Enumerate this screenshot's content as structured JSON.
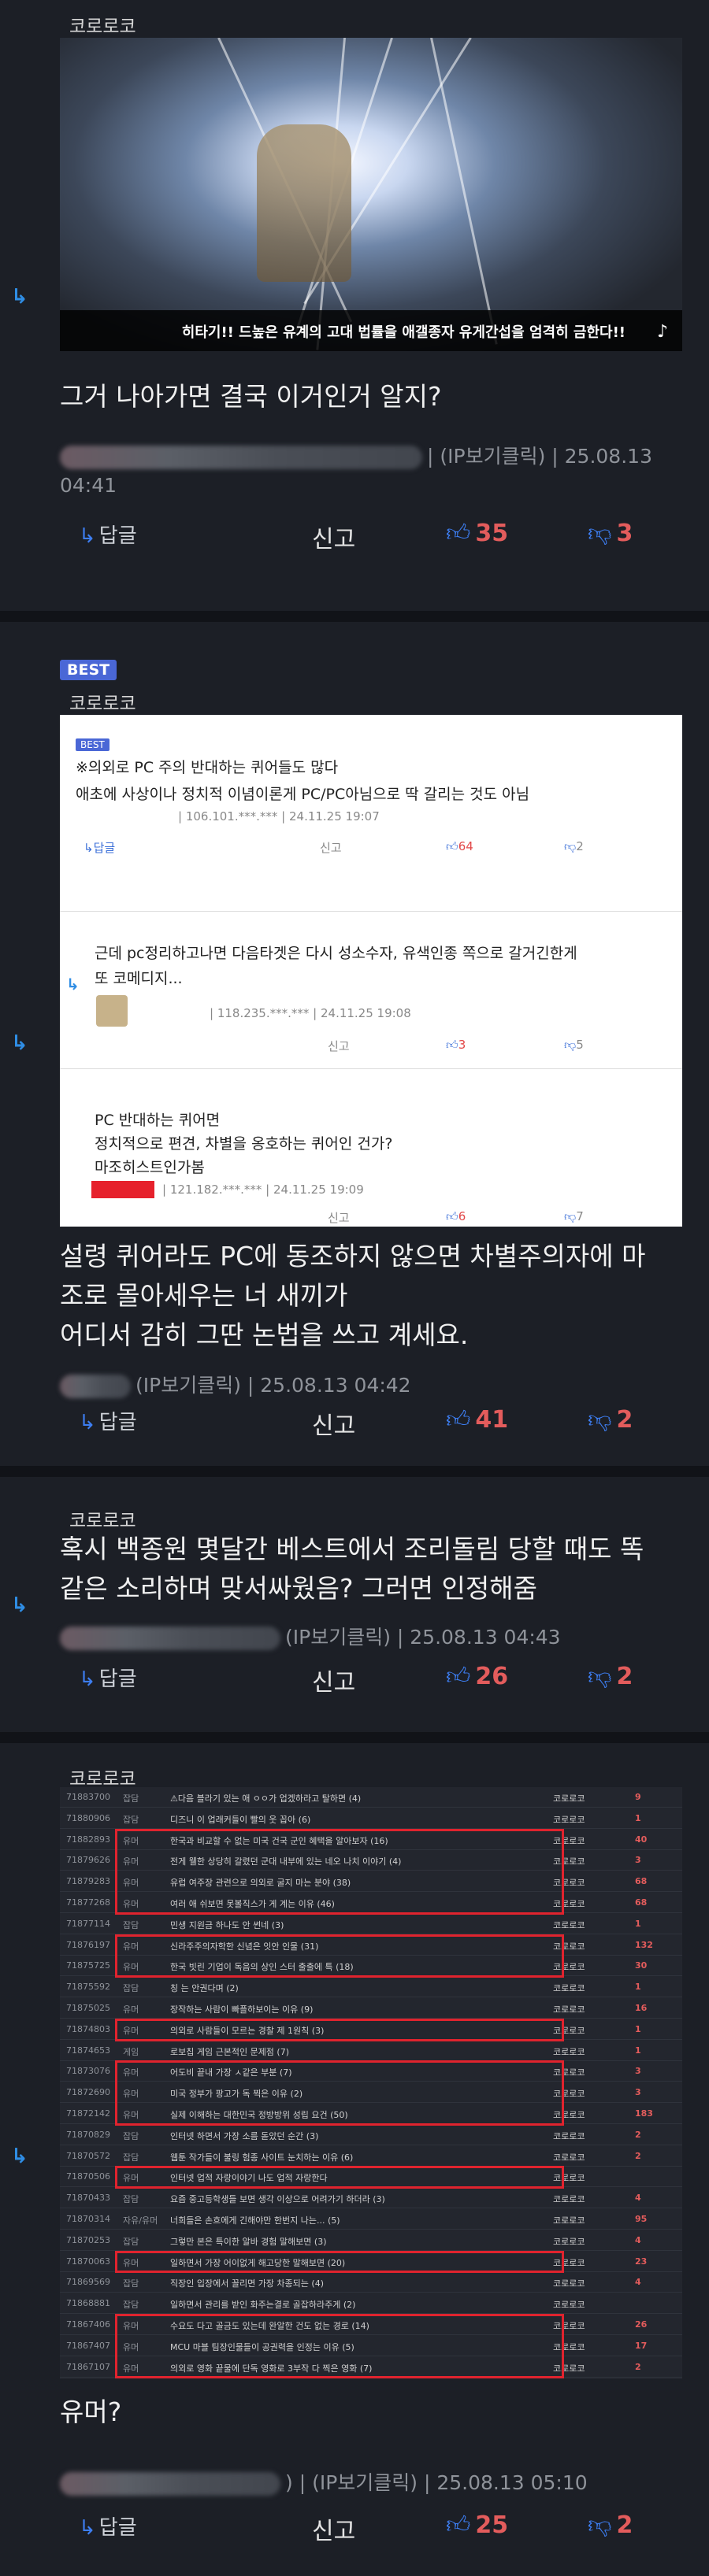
{
  "replies": [
    {
      "nick": "코로로코",
      "image_caption": "히타기!! 드높은 유계의 고대 법률을 애갤종자 유게간섭을 엄격히 금한다!!",
      "text": "그거 나아가면 결국 이거인거 알지?",
      "meta_ip": "| (IP보기클릭) | 25.08.13",
      "meta_time": "04:41",
      "reply_label": "답글",
      "report_label": "신고",
      "up": "35",
      "down": "3"
    },
    {
      "badge": "BEST",
      "nick": "코로로코",
      "quoted": {
        "best_badge": "BEST",
        "line1": "※의외로 PC 주의 반대하는 퀴어들도 많다",
        "line2": "애초에 사상이나 정치적 이념이론게 PC/PC아님으로 딱 갈리는 것도 아님",
        "meta1": "| 106.101.***.*** | 24.11.25 19:07",
        "reply1": "답글",
        "report1": "신고",
        "up1": "64",
        "down1": "2",
        "sub1_line1": "근데 pc정리하고나면 다음타겟은 다시 성소수자, 유색인종 쪽으로 갈거긴한게",
        "sub1_line2": "또 코메디지...",
        "sub1_meta": "| 118.235.***.*** | 24.11.25 19:08",
        "report2": "신고",
        "up2": "3",
        "down2": "5",
        "sub2_line1": "PC 반대하는 퀴어면",
        "sub2_line2": "정치적으로 편견, 차별을 옹호하는 퀴어인 건가?",
        "sub2_line3": "마조히스트인가봄",
        "sub2_meta": "| 121.182.***.*** | 24.11.25 19:09",
        "report3": "신고",
        "up3": "6",
        "down3": "7"
      },
      "text_line1": "설령 퀴어라도 PC에 동조하지 않으면 차별주의자에 마",
      "text_line2": "조로 몰아세우는 너 새끼가",
      "text_line3": "어디서 감히 그딴 논법을 쓰고 계세요.",
      "meta": "(IP보기클릭) | 25.08.13 04:42",
      "reply_label": "답글",
      "report_label": "신고",
      "up": "41",
      "down": "2"
    },
    {
      "nick": "코로로코",
      "text_line1": "혹시 백종원 몇달간 베스트에서 조리돌림 당할 때도 똑",
      "text_line2": "같은 소리하며 맞서싸웠음? 그러면 인정해줌",
      "meta": "(IP보기클릭) | 25.08.13 04:43",
      "reply_label": "답글",
      "report_label": "신고",
      "up": "26",
      "down": "2"
    },
    {
      "nick": "코로로코",
      "text": "유머?",
      "meta": ") | (IP보기클릭) | 25.08.13 05:10",
      "reply_label": "답글",
      "report_label": "신고",
      "up": "25",
      "down": "2"
    }
  ],
  "table_rows": [
    {
      "id": "71883700",
      "cat": "잡담",
      "title": "⚠다음 블라기 있는 애 ㅇㅇ가 업겠하라고 탈하면 (4)",
      "nick": "코로로코",
      "n": "9"
    },
    {
      "id": "71880906",
      "cat": "잡담",
      "title": "디즈니 이 업래커들이 빨의 웃 꼽아 (6)",
      "nick": "코로로코",
      "n": "1"
    },
    {
      "id": "71882893",
      "cat": "유머",
      "title": "한국과 비교할 수 없는 미국 건국 군인 혜택을 알아보자 (16)",
      "nick": "코로로코",
      "n": "40"
    },
    {
      "id": "71879626",
      "cat": "유머",
      "title": "전게 웰한 상당히 갈렸던 군대 내부에 있는 네오 나치 이야기 (4)",
      "nick": "코로로코",
      "n": "3"
    },
    {
      "id": "71879283",
      "cat": "유머",
      "title": "유럽 여주장 관련으로 의외로 굴지 마는 분야 (38)",
      "nick": "코로로코",
      "n": "68"
    },
    {
      "id": "71877268",
      "cat": "유머",
      "title": "여러 애 쉬보면 못볼직스가 게 계는 이유 (46)",
      "nick": "코로로코",
      "n": "68"
    },
    {
      "id": "71877114",
      "cat": "잡담",
      "title": "민생 지원금 하나도 안 썬네 (3)",
      "nick": "코로로코",
      "n": "1"
    },
    {
      "id": "71876197",
      "cat": "유머",
      "title": "신라주주의자학한 신념은 잇안 인물 (31)",
      "nick": "코로로코",
      "n": "132"
    },
    {
      "id": "71875725",
      "cat": "유머",
      "title": "한국 빗린 기업이 독음의 상인 스터 출출에 특 (18)",
      "nick": "코로로코",
      "n": "30"
    },
    {
      "id": "71875592",
      "cat": "잡담",
      "title": "칭 는 안권다며 (2)",
      "nick": "코로로코",
      "n": "1"
    },
    {
      "id": "71875025",
      "cat": "유머",
      "title": "장작하는 사람이 빠플하보이는 이유 (9)",
      "nick": "코로로코",
      "n": "16"
    },
    {
      "id": "71874803",
      "cat": "유머",
      "title": "의외로 사람들이 모르는 경찰 제 1원칙 (3)",
      "nick": "코로로코",
      "n": "1"
    },
    {
      "id": "71874653",
      "cat": "게임",
      "title": "로보칩 게임 근본적인 문제점 (7)",
      "nick": "코로로코",
      "n": "1"
    },
    {
      "id": "71873076",
      "cat": "유머",
      "title": "어도비 끝내 가장 ㅅ같은 부분 (7)",
      "nick": "코로로코",
      "n": "3"
    },
    {
      "id": "71872690",
      "cat": "유머",
      "title": "미국 정부가 팡고가 독 찍은 이유 (2)",
      "nick": "코로로코",
      "n": "3"
    },
    {
      "id": "71872142",
      "cat": "유머",
      "title": "실제 이해하는 대한민국 정방방위 성립 요건 (50)",
      "nick": "코로로코",
      "n": "183"
    },
    {
      "id": "71870829",
      "cat": "잡담",
      "title": "인터넷 하면서 가장 소름 돋았던 순간 (3)",
      "nick": "코로로코",
      "n": "2"
    },
    {
      "id": "71870572",
      "cat": "잡담",
      "title": "웹툰 작가들이 불링 험종 사이트 눈치하는 이유 (6)",
      "nick": "코로로코",
      "n": "2"
    },
    {
      "id": "71870506",
      "cat": "유머",
      "title": "인터넷 업적 자랑이야기 나도 업적 자랑한다",
      "nick": "코로로코",
      "n": ""
    },
    {
      "id": "71870433",
      "cat": "잡담",
      "title": "요즘 중고등학생들 보면 생각 이상으로 어려가기 하더라 (3)",
      "nick": "코로로코",
      "n": "4"
    },
    {
      "id": "71870314",
      "cat": "자유/유머",
      "title": "너희들은 손흐에게 긴해야만 한번지 나는... (5)",
      "nick": "코로로코",
      "n": "95"
    },
    {
      "id": "71870253",
      "cat": "잡담",
      "title": "그렇만 본은 특이한 알바 경험 말해보면 (3)",
      "nick": "코로로코",
      "n": "4"
    },
    {
      "id": "71870063",
      "cat": "유머",
      "title": "일하면서 가장 어이없게 해고당한 말해보면 (20)",
      "nick": "코로로코",
      "n": "23"
    },
    {
      "id": "71869569",
      "cat": "잡담",
      "title": "직장인 입장에서 꼴리면 가장 차종되는 (4)",
      "nick": "코로로코",
      "n": "4"
    },
    {
      "id": "71868881",
      "cat": "잡담",
      "title": "일하면서 관리를 받인 화주는결로 골잡하라주게 (2)",
      "nick": "코로로코",
      "n": ""
    },
    {
      "id": "71867406",
      "cat": "유머",
      "title": "수요도 다고 골금도 있는데 완알한 건도 없는 경로 (14)",
      "nick": "코로로코",
      "n": "26"
    },
    {
      "id": "71867407",
      "cat": "유머",
      "title": "MCU 마블 팀장인물들이 공권력을 인정는 이유 (5)",
      "nick": "코로로코",
      "n": "17"
    },
    {
      "id": "71867107",
      "cat": "유머",
      "title": "의외로 영화 끝물에 단독 영화로 3부작 다 찍은 영화 (7)",
      "nick": "코로로코",
      "n": "2"
    }
  ],
  "icons": {
    "reply_arrow": "reply-arrow-icon",
    "thumb_up": "thumb-up-icon",
    "thumb_down": "thumb-down-icon"
  },
  "colors": {
    "accent": "#2f8de4",
    "vote": "#e35c5c",
    "best_badge": "#4a67d6",
    "highlight": "#e0232e"
  }
}
